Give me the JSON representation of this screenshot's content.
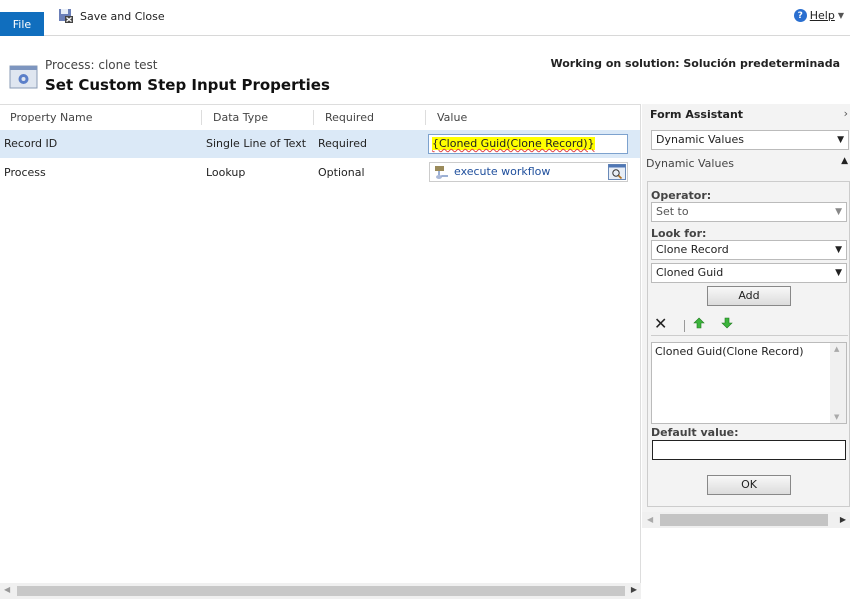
{
  "toolbar": {
    "file_label": "File",
    "save_close_label": "Save and Close",
    "help_label": "Help"
  },
  "header": {
    "process": "Process: clone test",
    "title": "Set Custom Step Input Properties",
    "solution": "Working on solution: Solución predeterminada"
  },
  "grid": {
    "columns": [
      "Property Name",
      "Data Type",
      "Required",
      "Value"
    ],
    "rows": [
      {
        "name": "Record ID",
        "type": "Single Line of Text",
        "required": "Required",
        "value": "{Cloned Guid(Clone Record)}",
        "selected": true
      },
      {
        "name": "Process",
        "type": "Lookup",
        "required": "Optional",
        "value": "execute workflow"
      }
    ]
  },
  "assistant": {
    "title": "Form Assistant",
    "mode_select": "Dynamic Values",
    "section_title": "Dynamic Values",
    "operator_label": "Operator:",
    "operator_value": "Set to",
    "look_for_label": "Look for:",
    "look_for_entity": "Clone Record",
    "look_for_field": "Cloned Guid",
    "add_label": "Add",
    "list_items": [
      "Cloned Guid(Clone Record)"
    ],
    "default_value_label": "Default value:",
    "default_value": "",
    "ok_label": "OK"
  },
  "colors": {
    "accent": "#106ebe",
    "selected_row": "#dbe9f7",
    "highlight": "#ffff00"
  }
}
